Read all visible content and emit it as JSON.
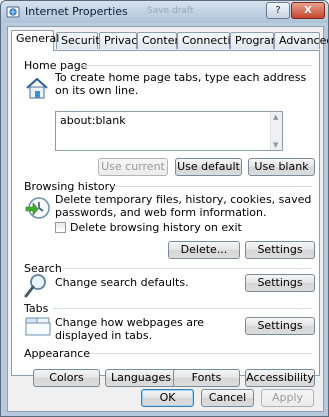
{
  "window": {
    "title": "Internet Properties",
    "background_title": "Save draft",
    "help_glyph": "?",
    "close_glyph": "X"
  },
  "tabs": [
    {
      "label": "General",
      "active": true
    },
    {
      "label": "Security",
      "active": false
    },
    {
      "label": "Privacy",
      "active": false
    },
    {
      "label": "Content",
      "active": false
    },
    {
      "label": "Connections",
      "active": false
    },
    {
      "label": "Programs",
      "active": false
    },
    {
      "label": "Advanced",
      "active": false
    }
  ],
  "home_page": {
    "label": "Home page",
    "description": "To create home page tabs, type each address on its own line.",
    "url": "about:blank",
    "use_current": "Use current",
    "use_default": "Use default",
    "use_blank": "Use blank",
    "use_current_enabled": false
  },
  "browsing_history": {
    "label": "Browsing history",
    "description": "Delete temporary files, history, cookies, saved passwords, and web form information.",
    "checkbox_label": "Delete browsing history on exit",
    "checkbox_checked": false,
    "delete_button": "Delete...",
    "settings_button": "Settings"
  },
  "search": {
    "label": "Search",
    "description": "Change search defaults.",
    "settings_button": "Settings"
  },
  "tabs_section": {
    "label": "Tabs",
    "description": "Change how webpages are displayed in tabs.",
    "settings_button": "Settings"
  },
  "appearance": {
    "label": "Appearance",
    "colors": "Colors",
    "languages": "Languages",
    "fonts": "Fonts",
    "accessibility": "Accessibility"
  },
  "footer": {
    "ok": "OK",
    "cancel": "Cancel",
    "apply": "Apply",
    "apply_enabled": false
  },
  "icons": {
    "home": "home-icon",
    "history": "history-icon",
    "search": "magnifier-icon",
    "tabs": "tabs-icon",
    "title": "internet-options-icon"
  },
  "colors": {
    "title_text": "#0a1a33",
    "close_button": "#c6462e",
    "default_button_border": "#3c7fb1"
  }
}
